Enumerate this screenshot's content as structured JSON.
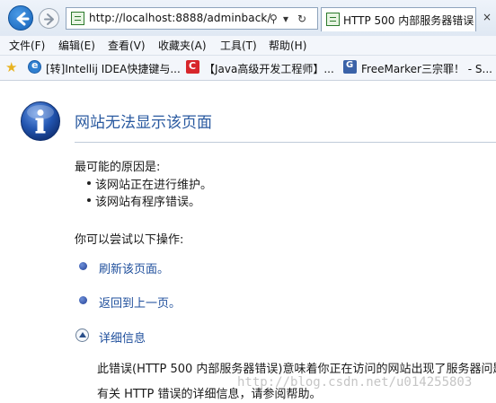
{
  "browser": {
    "address": "http://localhost:8888/adminback/",
    "tab_title": "HTTP 500 内部服务器错误",
    "tab_close": "×"
  },
  "menu": [
    "文件(F)",
    "编辑(E)",
    "查看(V)",
    "收藏夹(A)",
    "工具(T)",
    "帮助(H)"
  ],
  "favorites": [
    {
      "label": "[转]Intellij IDEA快捷键与...",
      "icon": "ie-icon"
    },
    {
      "label": "【Java高级开发工程师】...",
      "icon": "csdn-icon"
    },
    {
      "label": "FreeMarker三宗罪！ - S...",
      "icon": "site-icon"
    }
  ],
  "page": {
    "title": "网站无法显示该页面",
    "reasons_label": "最可能的原因是:",
    "reasons": [
      "该网站正在进行维护。",
      "该网站有程序错误。"
    ],
    "actions_label": "你可以尝试以下操作:",
    "actions": [
      "刷新该页面。",
      "返回到上一页。"
    ],
    "details_label": "详细信息",
    "details_text": [
      "此错误(HTTP 500 内部服务器错误)意味着你正在访问的网站出现了服务器问题",
      "有关 HTTP 错误的详细信息，请参阅帮助。"
    ]
  },
  "watermark": "http://blog.csdn.net/u014255803",
  "colors": {
    "title_blue": "#2a5aa0",
    "link_blue": "#1f4f9c",
    "info_icon_blue": "#2255b0"
  }
}
